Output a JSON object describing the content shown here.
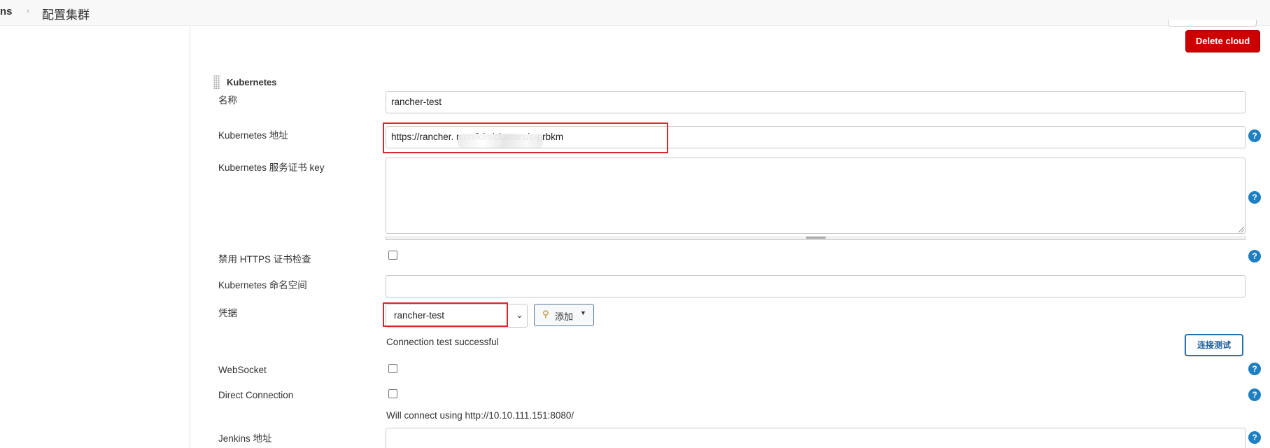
{
  "breadcrumb": {
    "app": "ns",
    "separator": "›",
    "page": "配置集群"
  },
  "toolbar": {
    "delete_cloud_label": "Delete cloud"
  },
  "section": {
    "title": "Kubernetes"
  },
  "form": {
    "name": {
      "label": "名称",
      "value": "rancher-test"
    },
    "url": {
      "label": "Kubernetes 地址",
      "value": "https://rancher.                    n.cn/k8s/clusters/c-prbkm"
    },
    "cert_key": {
      "label": "Kubernetes 服务证书 key",
      "value": ""
    },
    "disable_https": {
      "label": "禁用 HTTPS 证书检查",
      "checked": false
    },
    "namespace": {
      "label": "Kubernetes 命名空间",
      "value": ""
    },
    "credentials": {
      "label": "凭据",
      "selected": "rancher-test",
      "add_label": "添加"
    },
    "connection_status": "Connection test successful",
    "test_connection_label": "连接测试",
    "websocket": {
      "label": "WebSocket",
      "checked": false
    },
    "direct_connection": {
      "label": "Direct Connection",
      "checked": false,
      "hint": "Will connect using http://10.10.111.151:8080/"
    },
    "jenkins_url": {
      "label": "Jenkins 地址",
      "value": ""
    }
  },
  "help_icon_glyph": "?",
  "colors": {
    "danger": "#cc0000",
    "highlight": "#e0242b",
    "help": "#1e7fc2",
    "primary_outline": "#2b6da8"
  }
}
